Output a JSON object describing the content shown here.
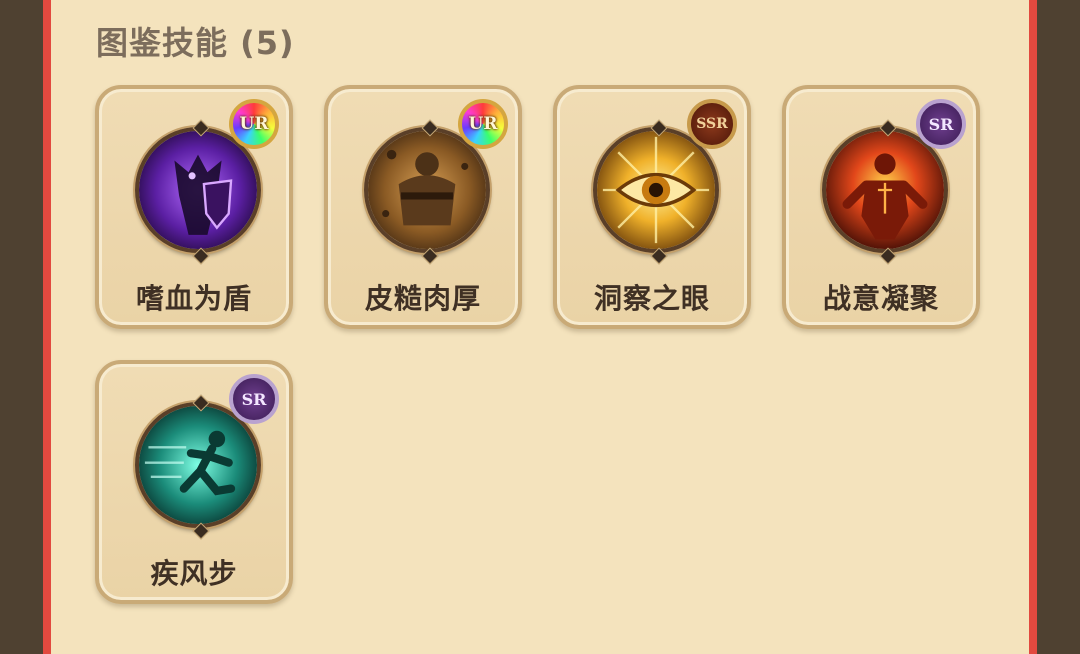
{
  "section": {
    "title": "图鉴技能 (5)"
  },
  "skills": [
    {
      "name": "嗜血为盾",
      "rarity": "UR",
      "icon": "dark-armored-shield-warrior-icon"
    },
    {
      "name": "皮糙肉厚",
      "rarity": "UR",
      "icon": "stone-golem-icon"
    },
    {
      "name": "洞察之眼",
      "rarity": "SSR",
      "icon": "golden-eye-icon"
    },
    {
      "name": "战意凝聚",
      "rarity": "SR",
      "icon": "fiery-warrior-icon"
    },
    {
      "name": "疾风步",
      "rarity": "SR",
      "icon": "running-figure-wind-icon"
    }
  ],
  "colors": {
    "ur_badge": "rainbow",
    "ssr_badge": "#6a2412",
    "sr_badge": "#4f2a6d",
    "card_border": "#c9aa77",
    "panel_frame": "#e2493f"
  }
}
